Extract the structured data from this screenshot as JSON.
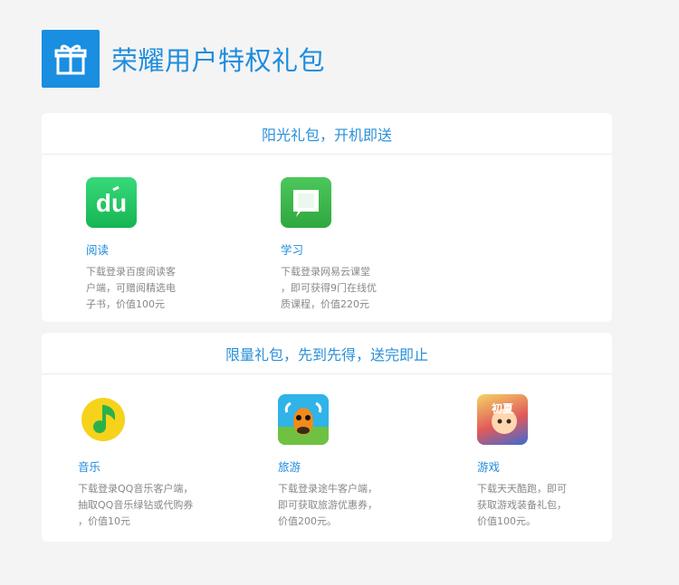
{
  "header": {
    "title": "荣耀用户特权礼包",
    "icon": "gift-icon"
  },
  "sections": [
    {
      "title": "阳光礼包，开机即送",
      "items": [
        {
          "name": "阅读",
          "desc_lines": [
            "下载登录百度阅读客",
            "户端，可赠阅精选电",
            "子书，价值100元"
          ],
          "icon": "baidu-read-icon",
          "icon_text": "du"
        },
        {
          "name": "学习",
          "desc_lines": [
            "下载登录网易云课堂",
            "，即可获得9门在线优",
            "质课程，价值220元"
          ],
          "icon": "netease-study-icon"
        }
      ]
    },
    {
      "title": "限量礼包，先到先得，送完即止",
      "items": [
        {
          "name": "音乐",
          "desc_lines": [
            "下载登录QQ音乐客户端，",
            "抽取QQ音乐绿钻或代购券",
            "，价值10元"
          ],
          "icon": "qq-music-icon"
        },
        {
          "name": "旅游",
          "desc_lines": [
            "下载登录途牛客户端，",
            "即可获取旅游优惠券，",
            "价值200元。"
          ],
          "icon": "tuniu-icon"
        },
        {
          "name": "游戏",
          "desc_lines": [
            "下载天天酷跑，即可",
            "获取游戏装备礼包，",
            "价值100元。"
          ],
          "icon": "game-icon",
          "icon_text": "初夏"
        }
      ]
    }
  ],
  "colors": {
    "accent": "#1d8ddd",
    "header_icon_bg": "#1a8ee0"
  }
}
